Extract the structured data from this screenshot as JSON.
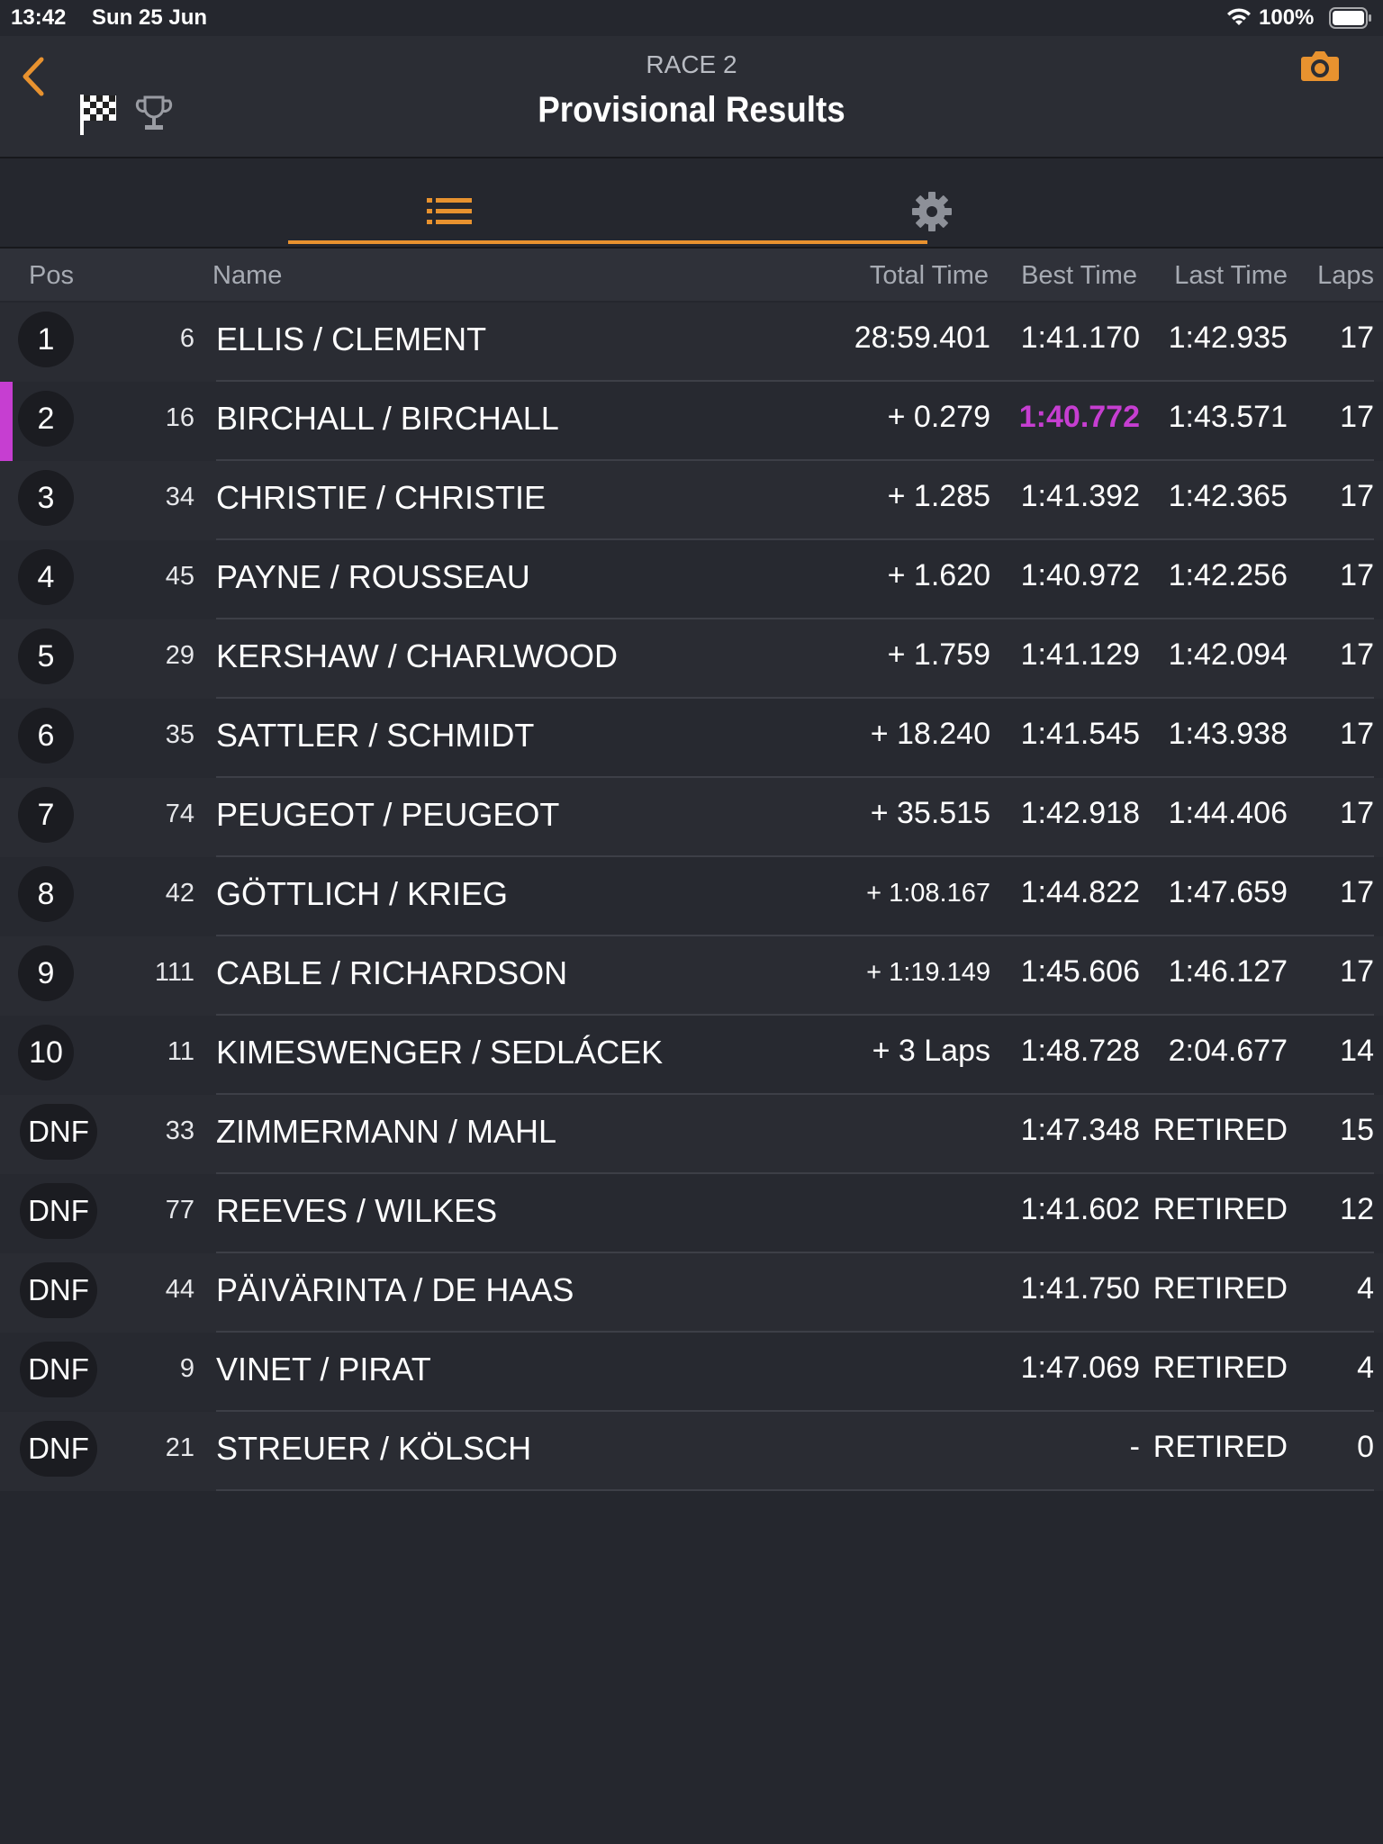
{
  "status_bar": {
    "time": "13:42",
    "date": "Sun 25 Jun",
    "battery": "100%"
  },
  "header": {
    "subtitle": "RACE 2",
    "title": "Provisional Results",
    "accent_color": "#e8922f",
    "icons": [
      "chevron-left-icon",
      "checkered-flag-icon",
      "trophy-icon",
      "camera-icon"
    ]
  },
  "tabs": [
    {
      "icon": "list-icon",
      "selected": true
    },
    {
      "icon": "gear-icon",
      "selected": false
    }
  ],
  "columns": {
    "pos": "Pos",
    "name": "Name",
    "total": "Total Time",
    "best": "Best Time",
    "last": "Last Time",
    "laps": "Laps"
  },
  "highlight_color": "#c63ed1",
  "results": [
    {
      "pos": "1",
      "num": "6",
      "name": "ELLIS / CLEMENT",
      "total": "28:59.401",
      "best": "1:41.170",
      "last": "1:42.935",
      "laps": "17"
    },
    {
      "pos": "2",
      "num": "16",
      "name": "BIRCHALL / BIRCHALL",
      "total": "+ 0.279",
      "best": "1:40.772",
      "last": "1:43.571",
      "laps": "17",
      "fastest": true
    },
    {
      "pos": "3",
      "num": "34",
      "name": "CHRISTIE / CHRISTIE",
      "total": "+ 1.285",
      "best": "1:41.392",
      "last": "1:42.365",
      "laps": "17"
    },
    {
      "pos": "4",
      "num": "45",
      "name": "PAYNE / ROUSSEAU",
      "total": "+ 1.620",
      "best": "1:40.972",
      "last": "1:42.256",
      "laps": "17"
    },
    {
      "pos": "5",
      "num": "29",
      "name": "KERSHAW / CHARLWOOD",
      "total": "+ 1.759",
      "best": "1:41.129",
      "last": "1:42.094",
      "laps": "17"
    },
    {
      "pos": "6",
      "num": "35",
      "name": "SATTLER / SCHMIDT",
      "total": "+ 18.240",
      "best": "1:41.545",
      "last": "1:43.938",
      "laps": "17"
    },
    {
      "pos": "7",
      "num": "74",
      "name": "PEUGEOT / PEUGEOT",
      "total": "+ 35.515",
      "best": "1:42.918",
      "last": "1:44.406",
      "laps": "17"
    },
    {
      "pos": "8",
      "num": "42",
      "name": "GÖTTLICH / KRIEG",
      "total": "+ 1:08.167",
      "best": "1:44.822",
      "last": "1:47.659",
      "laps": "17"
    },
    {
      "pos": "9",
      "num": "111",
      "name": "CABLE / RICHARDSON",
      "total": "+ 1:19.149",
      "best": "1:45.606",
      "last": "1:46.127",
      "laps": "17"
    },
    {
      "pos": "10",
      "num": "11",
      "name": "KIMESWENGER / SEDLÁCEK",
      "total": "+ 3 Laps",
      "best": "1:48.728",
      "last": "2:04.677",
      "laps": "14"
    },
    {
      "pos": "DNF",
      "num": "33",
      "name": "ZIMMERMANN / MAHL",
      "total": "",
      "best": "1:47.348",
      "last": "RETIRED",
      "laps": "15"
    },
    {
      "pos": "DNF",
      "num": "77",
      "name": "REEVES / WILKES",
      "total": "",
      "best": "1:41.602",
      "last": "RETIRED",
      "laps": "12"
    },
    {
      "pos": "DNF",
      "num": "44",
      "name": "PÄIVÄRINTA / DE HAAS",
      "total": "",
      "best": "1:41.750",
      "last": "RETIRED",
      "laps": "4"
    },
    {
      "pos": "DNF",
      "num": "9",
      "name": "VINET / PIRAT",
      "total": "",
      "best": "1:47.069",
      "last": "RETIRED",
      "laps": "4"
    },
    {
      "pos": "DNF",
      "num": "21",
      "name": "STREUER / KÖLSCH",
      "total": "",
      "best": "-",
      "last": "RETIRED",
      "laps": "0"
    }
  ]
}
